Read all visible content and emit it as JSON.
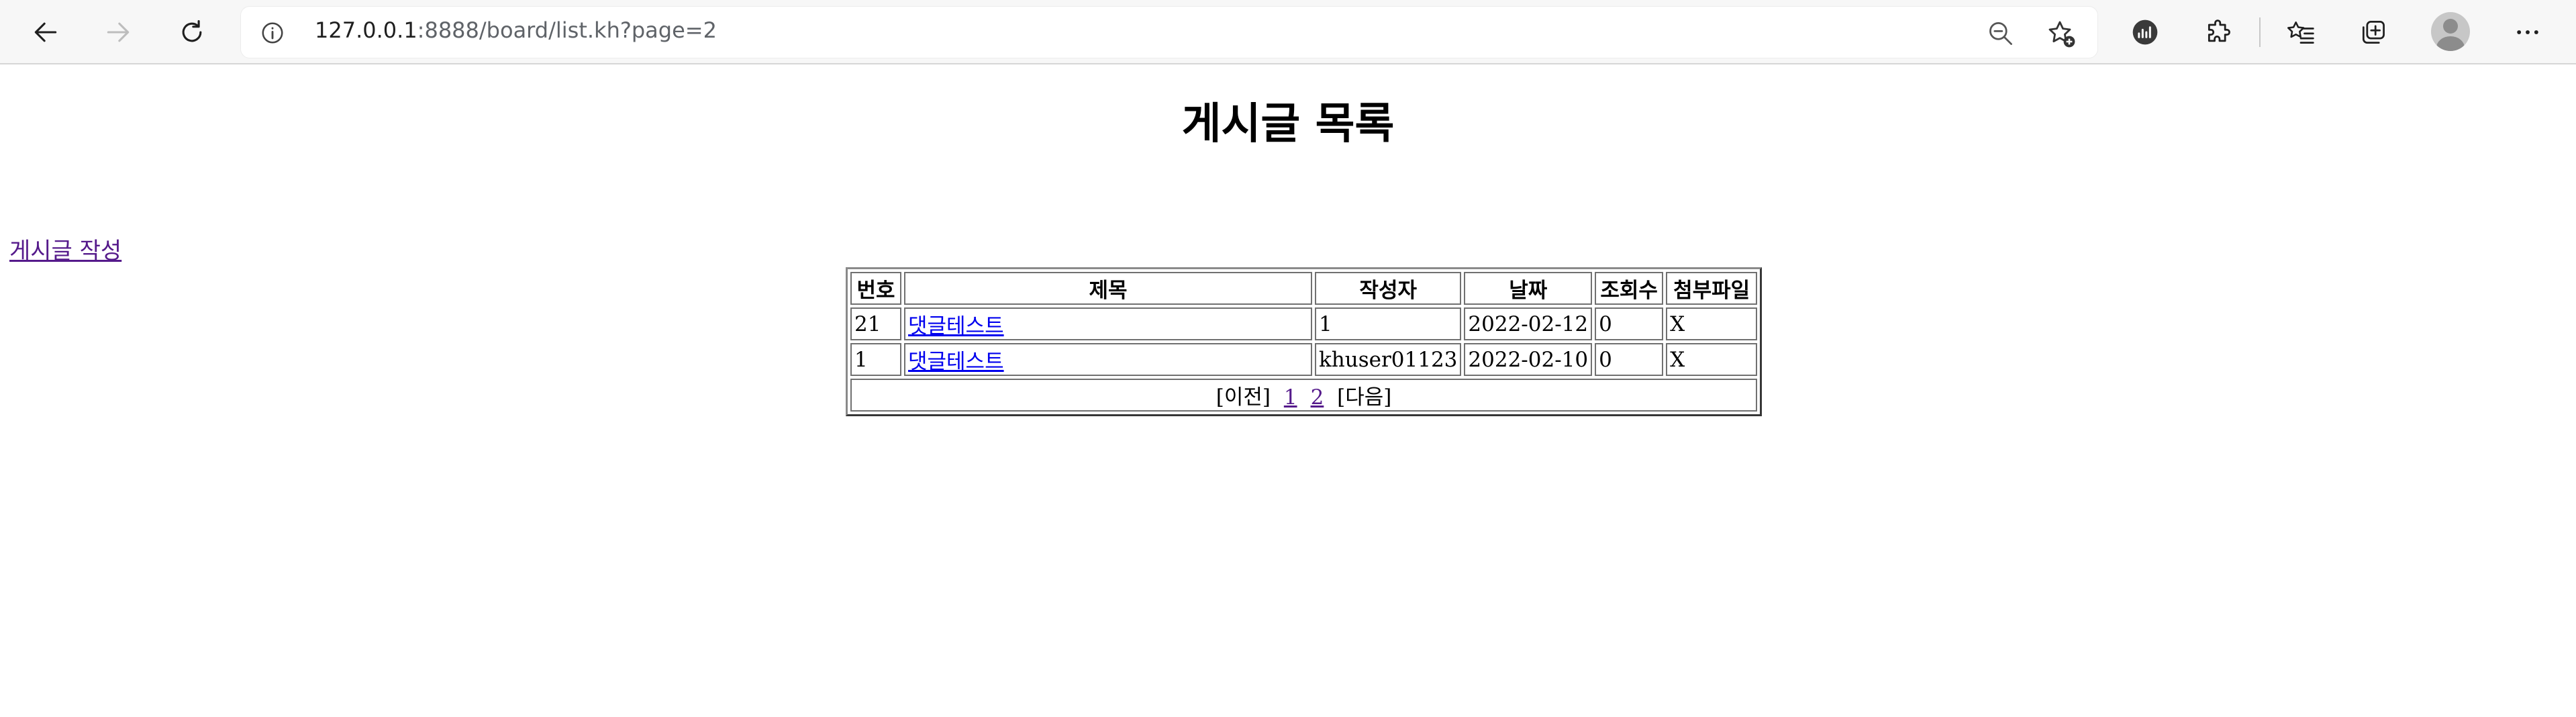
{
  "browser": {
    "url_host": "127.0.0.1",
    "url_rest": ":8888/board/list.kh?page=2"
  },
  "page": {
    "title": "게시글 목록",
    "write_link": "게시글 작성"
  },
  "table": {
    "headers": {
      "no": "번호",
      "title": "제목",
      "writer": "작성자",
      "date": "날짜",
      "views": "조회수",
      "file": "첨부파일"
    },
    "rows": [
      {
        "no": "21",
        "title": "댓글테스트",
        "writer": "1",
        "date": "2022-02-12",
        "views": "0",
        "file": "X"
      },
      {
        "no": "1",
        "title": "댓글테스트",
        "writer": "khuser01123",
        "date": "2022-02-10",
        "views": "0",
        "file": "X"
      }
    ],
    "pagination": {
      "prev": "[이전]",
      "pages": [
        "1",
        "2"
      ],
      "next": "[다음]"
    }
  },
  "icons": {
    "back": "arrow-left-icon",
    "forward": "arrow-right-icon",
    "reload": "reload-icon",
    "info": "info-icon",
    "zoom": "zoom-out-icon",
    "favorite": "star-add-icon",
    "performance": "performance-icon",
    "extensions": "puzzle-icon",
    "favorites": "favorites-icon",
    "collections": "collections-icon",
    "profile": "avatar-icon",
    "menu": "more-icon"
  },
  "colors": {
    "link": "#0000ee",
    "visited_link": "#551a8b",
    "toolbar_bg": "#f7f7f7"
  }
}
